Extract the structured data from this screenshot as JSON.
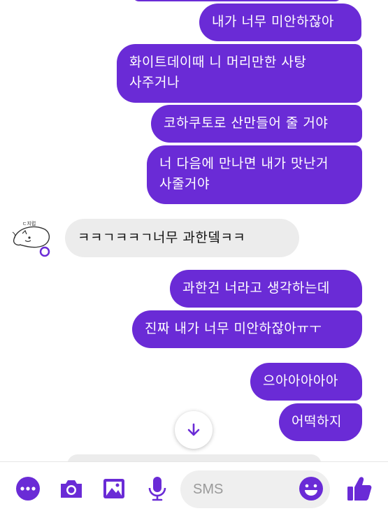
{
  "messages": [
    {
      "id": "m1",
      "side": "sent",
      "lines": [
        "내가 너무 미안하잖아"
      ]
    },
    {
      "id": "m2",
      "side": "sent",
      "lines": [
        "화이트데이때 니 머리만한 사탕",
        "사주거나"
      ]
    },
    {
      "id": "m3",
      "side": "sent",
      "lines": [
        "코하쿠토로 산만들어 줄 거야"
      ]
    },
    {
      "id": "m4",
      "side": "sent",
      "lines": [
        "너 다음에 만나면 내가 맛난거",
        "사줄거야"
      ]
    },
    {
      "id": "m5",
      "side": "received",
      "lines": [
        "ㅋㅋㄱㅋㅋㄱ너무 과한뎈ㅋㅋ"
      ]
    },
    {
      "id": "m6",
      "side": "sent",
      "lines": [
        "과한건 너라고 생각하는데"
      ]
    },
    {
      "id": "m7",
      "side": "sent",
      "lines": [
        "진짜 내가 너무 미안하잖아ㅠㅜ"
      ]
    },
    {
      "id": "m8",
      "side": "sent",
      "lines": [
        "으아아아아아"
      ]
    },
    {
      "id": "m9",
      "side": "sent",
      "lines": [
        "어떡하지"
      ]
    }
  ],
  "composer": {
    "placeholder": "SMS",
    "icons": [
      "more-icon",
      "camera-icon",
      "gallery-icon",
      "microphone-icon",
      "emoji-icon",
      "thumbs-up-icon"
    ]
  },
  "colors": {
    "sent_bubble": "#6a2bd6",
    "received_bubble": "#ececec",
    "accent": "#6a2bd6",
    "background": "#ffffff"
  }
}
